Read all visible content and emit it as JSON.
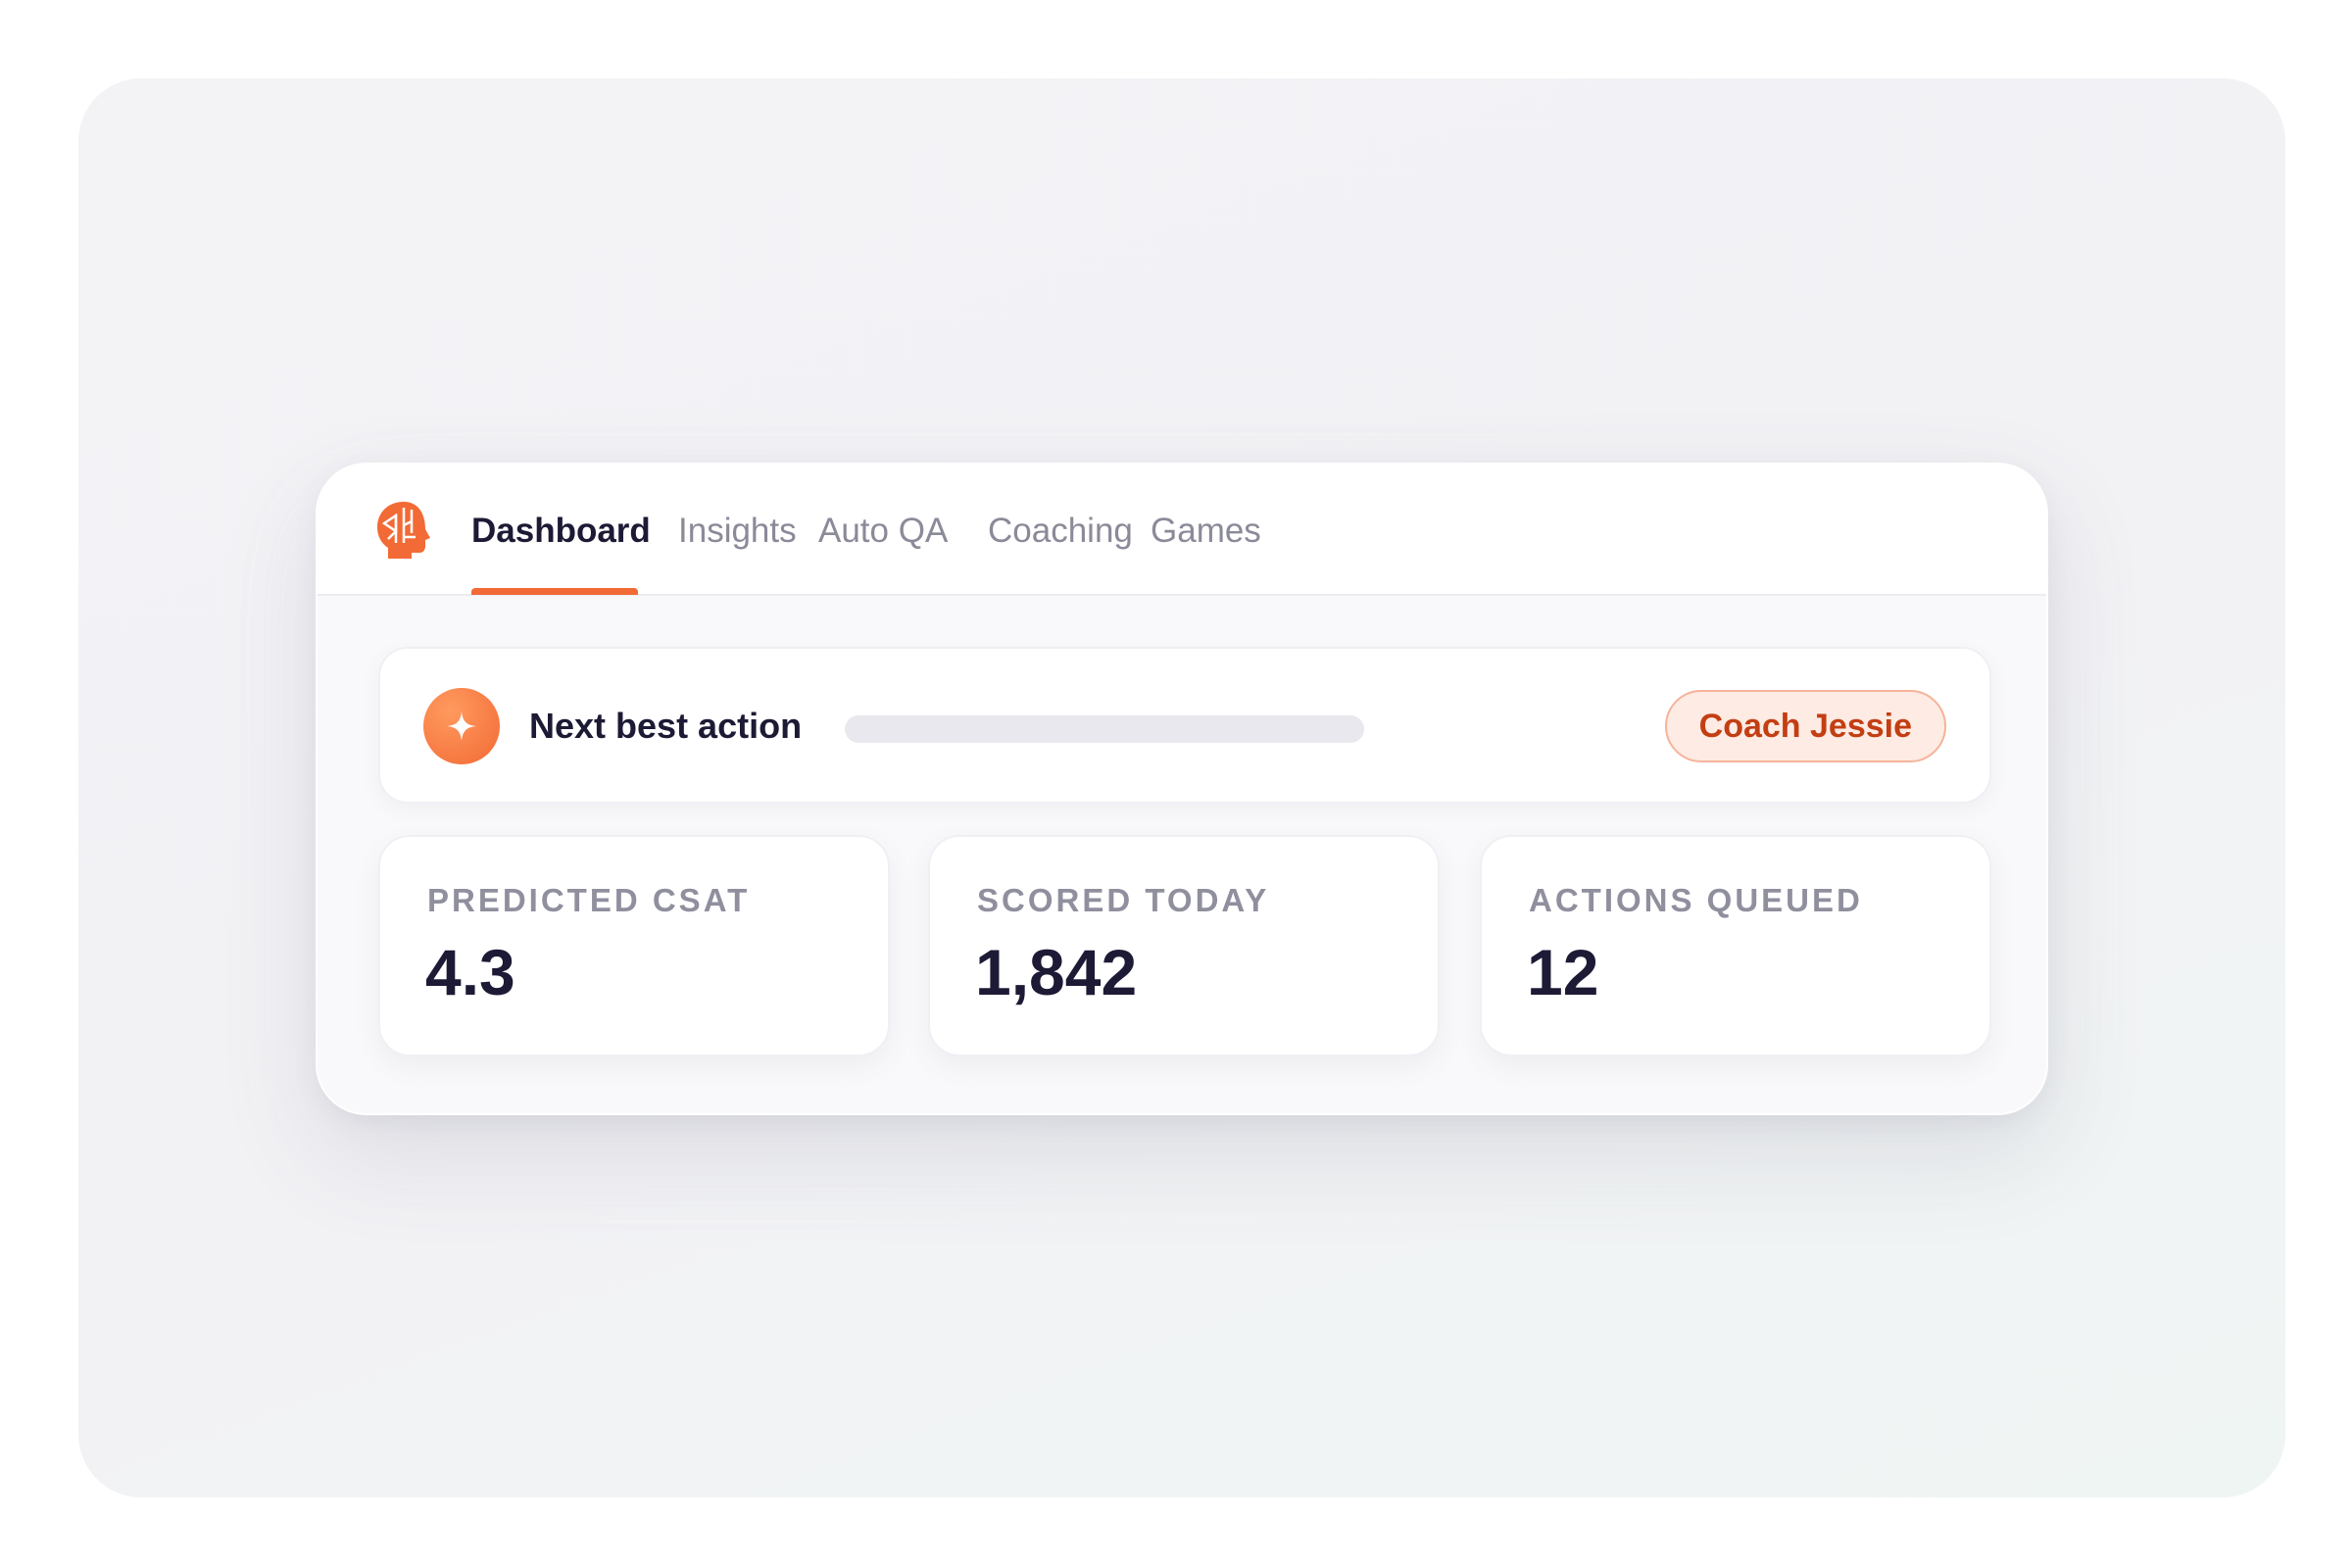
{
  "colors": {
    "accent": "#f26a35",
    "accent_light": "#ff9a5e",
    "text_dark": "#1c1a35",
    "text_muted": "#8a8a99",
    "button_bg": "#fdebe4",
    "button_border": "#f5b39a",
    "button_text": "#c33e12"
  },
  "header": {
    "logo_icon": "brain-head-logo-icon",
    "tabs": [
      {
        "label": "Dashboard",
        "active": true
      },
      {
        "label": "Insights",
        "active": false
      },
      {
        "label": "Auto QA",
        "active": false
      },
      {
        "label": "Coaching",
        "active": false
      },
      {
        "label": "Games",
        "active": false
      }
    ]
  },
  "next_action": {
    "icon": "sparkle-icon",
    "title": "Next best action",
    "button_label": "Coach Jessie"
  },
  "stats": [
    {
      "label": "PREDICTED CSAT",
      "value": "4.3"
    },
    {
      "label": "SCORED TODAY",
      "value": "1,842"
    },
    {
      "label": "ACTIONS QUEUED",
      "value": "12"
    }
  ]
}
